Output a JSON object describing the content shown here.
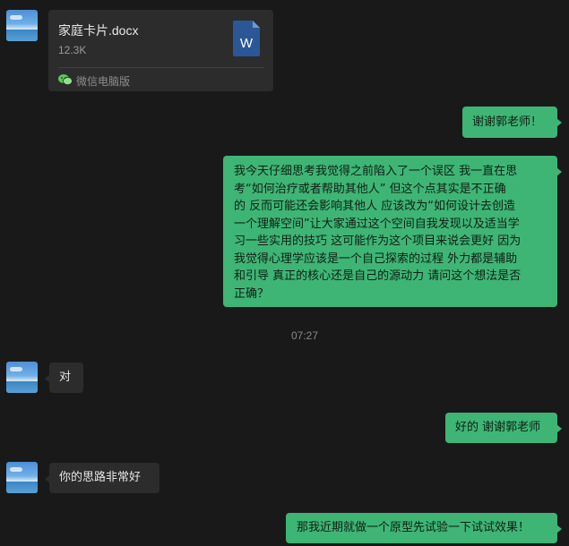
{
  "colors": {
    "background": "#191919",
    "my_bubble": "#3eb575",
    "other_bubble": "#2c2c2c",
    "word_blue": "#2b5797"
  },
  "file_message": {
    "file_name": "家庭卡片.docx",
    "file_size": "12.3K",
    "source": "微信电脑版",
    "file_icon": "word-doc-icon",
    "source_icon": "wechat-icon",
    "word_glyph": "W"
  },
  "messages": {
    "m1": "谢谢郭老师！",
    "m2_lines": [
      "我今天仔细思考我觉得之前陷入了一个误区 我一直在思",
      "考“如何治疗或者帮助其他人” 但这个点其实是不正确",
      "的 反而可能还会影响其他人 应该改为“如何设计去创造",
      "一个理解空间”让大家通过这个空间自我发现以及适当学",
      "习一些实用的技巧 这可能作为这个项目来说会更好 因为",
      "我觉得心理学应该是一个自己探索的过程 外力都是辅助",
      "和引导 真正的核心还是自己的源动力 请问这个想法是否",
      "正确？"
    ],
    "timestamp": "07:27",
    "m3": "对",
    "m4": "好的 谢谢郭老师",
    "m5": "你的思路非常好",
    "m6": "那我近期就做一个原型先试验一下试试效果！"
  }
}
